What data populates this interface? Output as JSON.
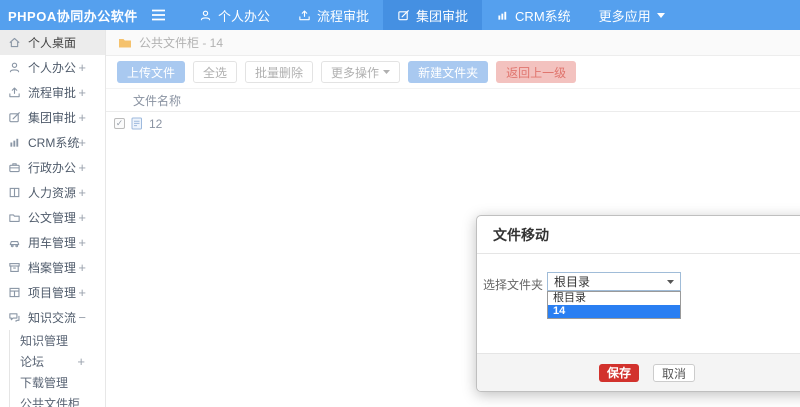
{
  "topbar": {
    "logo": "PHPOA协同办公软件",
    "nav": [
      {
        "label": "个人办公",
        "icon": "user-icon"
      },
      {
        "label": "流程审批",
        "icon": "upload-icon"
      },
      {
        "label": "集团审批",
        "icon": "edit-icon",
        "active": true
      },
      {
        "label": "CRM系统",
        "icon": "chart-icon"
      },
      {
        "label": "更多应用",
        "icon": "caret-down-icon"
      }
    ]
  },
  "sidebar": {
    "items": [
      {
        "label": "个人桌面",
        "icon": "home-icon",
        "expand": "",
        "active": true
      },
      {
        "label": "个人办公",
        "icon": "user-icon",
        "expand": "+"
      },
      {
        "label": "流程审批",
        "icon": "upload-icon",
        "expand": "+"
      },
      {
        "label": "集团审批",
        "icon": "edit-icon",
        "expand": "+"
      },
      {
        "label": "CRM系统",
        "icon": "chart-icon",
        "expand": "+"
      },
      {
        "label": "行政办公",
        "icon": "briefcase-icon",
        "expand": "+"
      },
      {
        "label": "人力资源",
        "icon": "book-icon",
        "expand": "+"
      },
      {
        "label": "公文管理",
        "icon": "folder-icon",
        "expand": "+"
      },
      {
        "label": "用车管理",
        "icon": "car-icon",
        "expand": "+"
      },
      {
        "label": "档案管理",
        "icon": "archive-icon",
        "expand": "+"
      },
      {
        "label": "项目管理",
        "icon": "project-icon",
        "expand": "+"
      },
      {
        "label": "知识交流",
        "icon": "chat-icon",
        "expand": "−",
        "children": [
          {
            "label": "知识管理",
            "expand": ""
          },
          {
            "label": "论坛",
            "expand": "+"
          },
          {
            "label": "下载管理",
            "expand": ""
          },
          {
            "label": "公共文件柜",
            "expand": ""
          }
        ]
      }
    ]
  },
  "main": {
    "breadcrumb": "公共文件柜 - 14",
    "toolbar": [
      {
        "label": "上传文件"
      },
      {
        "label": "全选"
      },
      {
        "label": "批量删除"
      },
      {
        "label": "更多操作"
      },
      {
        "label": "新建文件夹"
      },
      {
        "label": "返回上一级"
      }
    ],
    "table_header": "文件名称",
    "rows": [
      {
        "name": "12",
        "checked": true
      }
    ]
  },
  "modal": {
    "title": "文件移动",
    "field_label": "选择文件夹",
    "select_value": "根目录",
    "options": [
      {
        "label": "根目录",
        "selected": false
      },
      {
        "label": "14",
        "selected": true
      }
    ],
    "save_label": "保存",
    "cancel_label": "取消"
  },
  "colors": {
    "topbar_blue": "#55a0ee",
    "nav_active_blue": "#4590e2",
    "soft_primary": "#a9c9f0",
    "soft_danger": "#f3c2bf",
    "save_red": "#d2322d",
    "option_highlight": "#2a7ff2",
    "breadcrumb_folder": "#f5c26d"
  }
}
